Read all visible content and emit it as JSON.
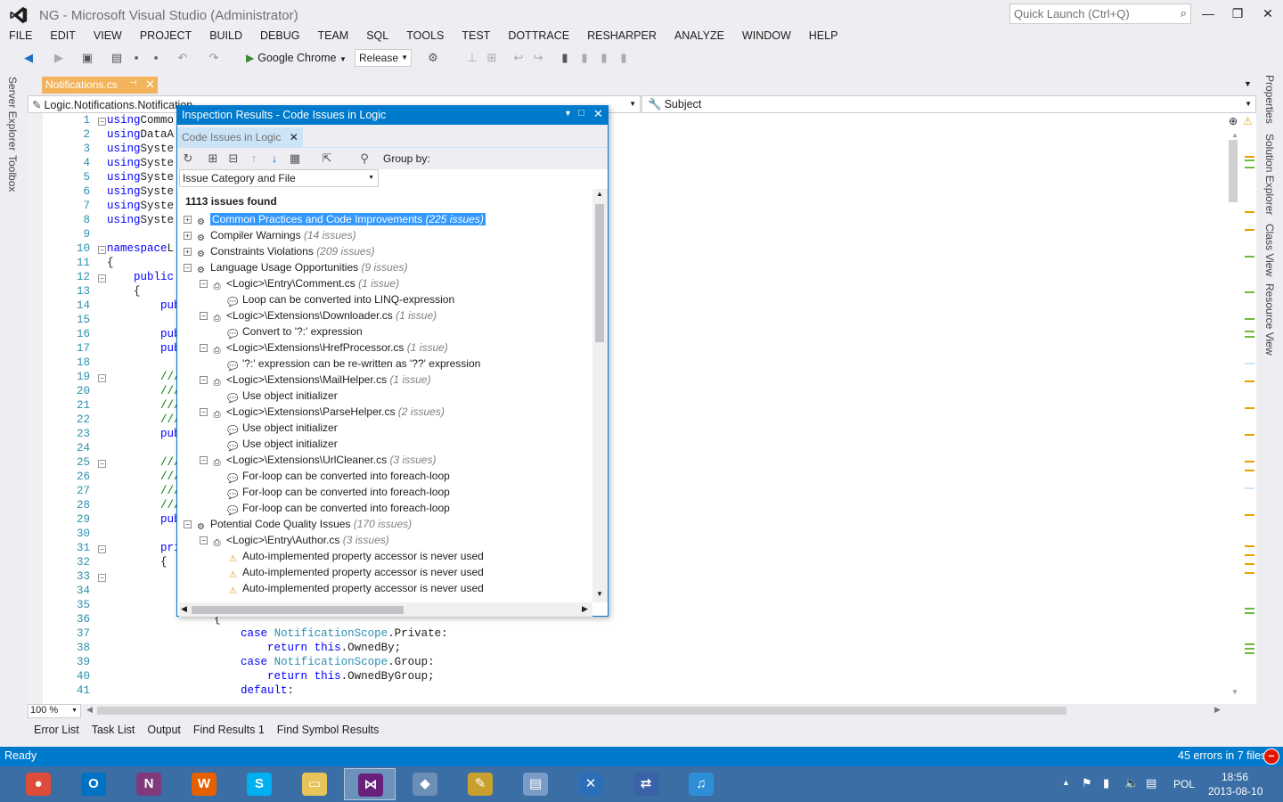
{
  "window": {
    "title": "NG - Microsoft Visual Studio (Administrator)",
    "quick_launch_placeholder": "Quick Launch (Ctrl+Q)"
  },
  "menu": [
    "FILE",
    "EDIT",
    "VIEW",
    "PROJECT",
    "BUILD",
    "DEBUG",
    "TEAM",
    "SQL",
    "TOOLS",
    "TEST",
    "DOTTRACE",
    "RESHARPER",
    "ANALYZE",
    "WINDOW",
    "HELP"
  ],
  "toolbar": {
    "run_target": "Google Chrome",
    "configuration": "Release"
  },
  "side_left": [
    "Server Explorer",
    "Toolbox"
  ],
  "side_right": [
    "Properties",
    "Solution Explorer",
    "Class View",
    "Resource View"
  ],
  "doc_tab": {
    "label": "Notifications.cs"
  },
  "nav": {
    "left": "Logic.Notifications.Notification",
    "right": "Subject"
  },
  "editor": {
    "lines": [
      {
        "n": "1",
        "t": [
          [
            "kw",
            "using"
          ],
          [
            "",
            "Commo"
          ]
        ]
      },
      {
        "n": "2",
        "t": [
          [
            "kw",
            "using"
          ],
          [
            "",
            "DataA"
          ]
        ]
      },
      {
        "n": "3",
        "t": [
          [
            "kw",
            "using"
          ],
          [
            "",
            "Syste"
          ]
        ]
      },
      {
        "n": "4",
        "t": [
          [
            "kw",
            "using"
          ],
          [
            "",
            "Syste"
          ]
        ]
      },
      {
        "n": "5",
        "t": [
          [
            "kw",
            "using"
          ],
          [
            "",
            "Syste"
          ]
        ]
      },
      {
        "n": "6",
        "t": [
          [
            "kw",
            "using"
          ],
          [
            "",
            "Syste"
          ]
        ]
      },
      {
        "n": "7",
        "t": [
          [
            "kw",
            "using"
          ],
          [
            "",
            "Syste"
          ]
        ]
      },
      {
        "n": "8",
        "t": [
          [
            "kw",
            "using"
          ],
          [
            "",
            "Syste"
          ]
        ]
      },
      {
        "n": "9",
        "t": []
      },
      {
        "n": "10",
        "t": [
          [
            "kw",
            "namespace"
          ],
          [
            "",
            "L"
          ]
        ]
      },
      {
        "n": "11",
        "t": [
          [
            "",
            "{"
          ]
        ]
      },
      {
        "n": "12",
        "t": [
          [
            "",
            "    "
          ],
          [
            "kw",
            "public"
          ]
        ]
      },
      {
        "n": "13",
        "t": [
          [
            "",
            "    {"
          ]
        ]
      },
      {
        "n": "14",
        "t": [
          [
            "",
            "        "
          ],
          [
            "kw",
            "pub"
          ]
        ]
      },
      {
        "n": "15",
        "t": []
      },
      {
        "n": "16",
        "t": [
          [
            "",
            "        "
          ],
          [
            "kw",
            "pub"
          ]
        ]
      },
      {
        "n": "17",
        "t": [
          [
            "",
            "        "
          ],
          [
            "kw",
            "pub"
          ]
        ]
      },
      {
        "n": "18",
        "t": []
      },
      {
        "n": "19",
        "t": [
          [
            "",
            "        "
          ],
          [
            "cm",
            "///"
          ]
        ]
      },
      {
        "n": "20",
        "t": [
          [
            "",
            "        "
          ],
          [
            "cm",
            "///"
          ]
        ]
      },
      {
        "n": "21",
        "t": [
          [
            "",
            "        "
          ],
          [
            "cm",
            "///"
          ]
        ]
      },
      {
        "n": "22",
        "t": [
          [
            "",
            "        "
          ],
          [
            "cm",
            "///"
          ]
        ]
      },
      {
        "n": "23",
        "t": [
          [
            "",
            "        "
          ],
          [
            "kw",
            "pub"
          ]
        ]
      },
      {
        "n": "24",
        "t": []
      },
      {
        "n": "25",
        "t": [
          [
            "",
            "        "
          ],
          [
            "cm",
            "///"
          ]
        ]
      },
      {
        "n": "26",
        "t": [
          [
            "",
            "        "
          ],
          [
            "cm",
            "///"
          ]
        ]
      },
      {
        "n": "27",
        "t": [
          [
            "",
            "        "
          ],
          [
            "cm",
            "///"
          ]
        ]
      },
      {
        "n": "28",
        "t": [
          [
            "",
            "        "
          ],
          [
            "cm",
            "///"
          ]
        ]
      },
      {
        "n": "29",
        "t": [
          [
            "",
            "        "
          ],
          [
            "kw",
            "pub"
          ]
        ]
      },
      {
        "n": "30",
        "t": []
      },
      {
        "n": "31",
        "t": [
          [
            "",
            "        "
          ],
          [
            "kw",
            "pri"
          ]
        ]
      },
      {
        "n": "32",
        "t": [
          [
            "",
            "        {"
          ]
        ]
      },
      {
        "n": "33",
        "t": []
      },
      {
        "n": "34",
        "t": []
      },
      {
        "n": "35",
        "t": []
      },
      {
        "n": "36",
        "t": [
          [
            "",
            "                {"
          ]
        ]
      },
      {
        "n": "37",
        "t": [
          [
            "",
            "                    "
          ],
          [
            "kw",
            "case"
          ],
          [
            "",
            " "
          ],
          [
            "ty",
            "NotificationScope"
          ],
          [
            "",
            ".Private:"
          ]
        ]
      },
      {
        "n": "38",
        "t": [
          [
            "",
            "                        "
          ],
          [
            "kw",
            "return"
          ],
          [
            "",
            " "
          ],
          [
            "kw",
            "this"
          ],
          [
            "",
            ".OwnedBy;"
          ]
        ]
      },
      {
        "n": "39",
        "t": [
          [
            "",
            "                    "
          ],
          [
            "kw",
            "case"
          ],
          [
            "",
            " "
          ],
          [
            "ty",
            "NotificationScope"
          ],
          [
            "",
            ".Group:"
          ]
        ]
      },
      {
        "n": "40",
        "t": [
          [
            "",
            "                        "
          ],
          [
            "kw",
            "return"
          ],
          [
            "",
            " "
          ],
          [
            "kw",
            "this"
          ],
          [
            "",
            ".OwnedByGroup;"
          ]
        ]
      },
      {
        "n": "41",
        "t": [
          [
            "",
            "                    "
          ],
          [
            "kw",
            "default"
          ],
          [
            "",
            ":"
          ]
        ]
      }
    ],
    "zoom": "100 %"
  },
  "bottom_tabs": [
    "Error List",
    "Task List",
    "Output",
    "Find Results 1",
    "Find Symbol Results"
  ],
  "status": {
    "left": "Ready",
    "right": "45 errors in 7 files"
  },
  "inspection": {
    "title": "Inspection Results - Code Issues in Logic",
    "tab": "Code Issues in Logic",
    "group_by_label": "Group by:",
    "group_by_value": "Issue Category and File",
    "summary": "1113 issues found",
    "rows": [
      {
        "lvl": 0,
        "exp": "+",
        "icon": "category",
        "text": "Common Practices and Code Improvements",
        "count": "(225 issues)",
        "selected": true
      },
      {
        "lvl": 0,
        "exp": "+",
        "icon": "category",
        "text": "Compiler Warnings",
        "count": "(14 issues)"
      },
      {
        "lvl": 0,
        "exp": "+",
        "icon": "category",
        "text": "Constraints Violations",
        "count": "(209 issues)"
      },
      {
        "lvl": 0,
        "exp": "-",
        "icon": "category",
        "text": "Language Usage Opportunities",
        "count": "(9 issues)"
      },
      {
        "lvl": 1,
        "exp": "-",
        "icon": "file",
        "text": "<Logic>\\Entry\\Comment.cs",
        "count": "(1 issue)"
      },
      {
        "lvl": 2,
        "exp": "",
        "icon": "hint",
        "text": "Loop can be converted into LINQ-expression",
        "count": ""
      },
      {
        "lvl": 1,
        "exp": "-",
        "icon": "file",
        "text": "<Logic>\\Extensions\\Downloader.cs",
        "count": "(1 issue)"
      },
      {
        "lvl": 2,
        "exp": "",
        "icon": "hint",
        "text": "Convert to '?:' expression",
        "count": ""
      },
      {
        "lvl": 1,
        "exp": "-",
        "icon": "file",
        "text": "<Logic>\\Extensions\\HrefProcessor.cs",
        "count": "(1 issue)"
      },
      {
        "lvl": 2,
        "exp": "",
        "icon": "hint",
        "text": "'?:' expression can be re-written as '??' expression",
        "count": ""
      },
      {
        "lvl": 1,
        "exp": "-",
        "icon": "file",
        "text": "<Logic>\\Extensions\\MailHelper.cs",
        "count": "(1 issue)"
      },
      {
        "lvl": 2,
        "exp": "",
        "icon": "hint",
        "text": "Use object initializer",
        "count": ""
      },
      {
        "lvl": 1,
        "exp": "-",
        "icon": "file",
        "text": "<Logic>\\Extensions\\ParseHelper.cs",
        "count": "(2 issues)"
      },
      {
        "lvl": 2,
        "exp": "",
        "icon": "hint",
        "text": "Use object initializer",
        "count": ""
      },
      {
        "lvl": 2,
        "exp": "",
        "icon": "hint",
        "text": "Use object initializer",
        "count": ""
      },
      {
        "lvl": 1,
        "exp": "-",
        "icon": "file",
        "text": "<Logic>\\Extensions\\UrlCleaner.cs",
        "count": "(3 issues)"
      },
      {
        "lvl": 2,
        "exp": "",
        "icon": "hint",
        "text": "For-loop can be converted into foreach-loop",
        "count": ""
      },
      {
        "lvl": 2,
        "exp": "",
        "icon": "hint",
        "text": "For-loop can be converted into foreach-loop",
        "count": ""
      },
      {
        "lvl": 2,
        "exp": "",
        "icon": "hint",
        "text": "For-loop can be converted into foreach-loop",
        "count": ""
      },
      {
        "lvl": 0,
        "exp": "-",
        "icon": "category",
        "text": "Potential Code Quality Issues",
        "count": "(170 issues)"
      },
      {
        "lvl": 1,
        "exp": "-",
        "icon": "file",
        "text": "<Logic>\\Entry\\Author.cs",
        "count": "(3 issues)"
      },
      {
        "lvl": 2,
        "exp": "",
        "icon": "warning",
        "text": "Auto-implemented property accessor is never used",
        "count": ""
      },
      {
        "lvl": 2,
        "exp": "",
        "icon": "warning",
        "text": "Auto-implemented property accessor is never used",
        "count": ""
      },
      {
        "lvl": 2,
        "exp": "",
        "icon": "warning",
        "text": "Auto-implemented property accessor is never used",
        "count": ""
      }
    ]
  },
  "taskbar": {
    "apps": [
      {
        "name": "chrome-icon",
        "color": "#dd4b39",
        "glyph": "●"
      },
      {
        "name": "outlook-icon",
        "color": "#0072c6",
        "glyph": "O"
      },
      {
        "name": "onenote-icon",
        "color": "#80397b",
        "glyph": "N"
      },
      {
        "name": "firefox-icon",
        "color": "#e66000",
        "glyph": "W"
      },
      {
        "name": "skype-icon",
        "color": "#00aff0",
        "glyph": "S"
      },
      {
        "name": "explorer-icon",
        "color": "#e8c35a",
        "glyph": "▭"
      },
      {
        "name": "visual-studio-icon",
        "color": "#68217a",
        "glyph": "⋈"
      },
      {
        "name": "network-icon",
        "color": "#6b8fb5",
        "glyph": "◆"
      },
      {
        "name": "tools-icon",
        "color": "#c8a030",
        "glyph": "✎"
      },
      {
        "name": "remote-desktop-icon",
        "color": "#7a9cc6",
        "glyph": "▤"
      },
      {
        "name": "xamarin-icon",
        "color": "#2c6fb7",
        "glyph": "✕"
      },
      {
        "name": "connections-icon",
        "color": "#3a62a8",
        "glyph": "⇄"
      },
      {
        "name": "itunes-icon",
        "color": "#2e8fd8",
        "glyph": "♫"
      }
    ],
    "language": "POL",
    "time": "18:56",
    "date": "2013-08-10"
  }
}
